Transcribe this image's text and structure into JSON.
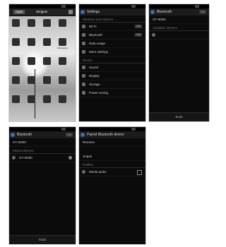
{
  "screen1": {
    "tabs": [
      "Apps",
      "Widgets"
    ],
    "apps": [
      {
        "icon": "settings-app-icon",
        "label": ""
      },
      {
        "icon": "download-app-icon",
        "label": ""
      },
      {
        "icon": "folder-app-icon",
        "label": ""
      },
      {
        "icon": "app-icon",
        "label": ""
      },
      {
        "icon": "app-icon",
        "label": ""
      },
      {
        "icon": "chrome-app-icon",
        "label": ""
      },
      {
        "icon": "app-icon",
        "label": ""
      },
      {
        "icon": "messaging-app-icon",
        "label": "Messaging"
      },
      {
        "icon": "app-icon",
        "label": ""
      },
      {
        "icon": "app-icon",
        "label": ""
      },
      {
        "icon": "google-app-icon",
        "label": ""
      },
      {
        "icon": "phone-app-icon",
        "label": ""
      },
      {
        "icon": "app-icon",
        "label": ""
      },
      {
        "icon": "app-icon",
        "label": ""
      },
      {
        "icon": "contacts-app-icon",
        "label": ""
      },
      {
        "icon": "app-icon",
        "label": ""
      },
      {
        "icon": "app-icon",
        "label": ""
      },
      {
        "icon": "app-icon",
        "label": ""
      },
      {
        "icon": "facebook-app-icon",
        "label": ""
      },
      {
        "icon": "app-icon",
        "label": ""
      }
    ]
  },
  "screen2": {
    "title": "Settings",
    "section1": "Wireless and network",
    "rows1": [
      {
        "label": "Wi-Fi",
        "toggle": "ON"
      },
      {
        "label": "Bluetooth",
        "toggle": "ON"
      },
      {
        "label": "Data usage",
        "toggle": ""
      },
      {
        "label": "More settings",
        "toggle": ""
      }
    ],
    "section2": "Device",
    "rows2": [
      {
        "label": "Sound"
      },
      {
        "label": "Display"
      },
      {
        "label": "Storage"
      },
      {
        "label": "Power saving"
      }
    ]
  },
  "screen3": {
    "title": "Bluetooth",
    "toggle": "ON",
    "device_name": "GT-I9300",
    "section": "Available devices",
    "bottom_button": "Scan"
  },
  "screen4": {
    "title": "Bluetooth",
    "toggle": "ON",
    "device_name": "GT-I9300",
    "section": "Paired devices",
    "paired_device": "GT-I9300",
    "bottom_button": "Scan"
  },
  "screen5": {
    "title": "Paired Bluetooth device",
    "rename_label": "Rename",
    "unpair_label": "Unpair",
    "section": "Profiles",
    "profile_label": "Media audio"
  }
}
